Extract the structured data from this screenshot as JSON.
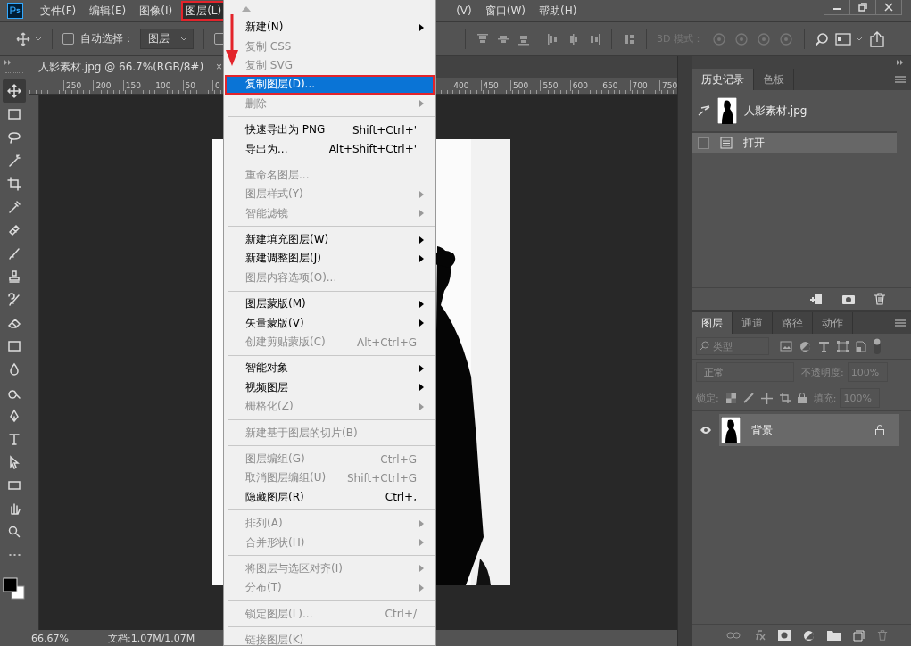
{
  "menubar": {
    "items": [
      {
        "label": "文件(F)",
        "selected": false,
        "annotated": false
      },
      {
        "label": "编辑(E)",
        "selected": false,
        "annotated": false
      },
      {
        "label": "图像(I)",
        "selected": false,
        "annotated": false
      },
      {
        "label": "图层(L)",
        "selected": true,
        "annotated": true
      },
      {
        "label": "(V)",
        "selected": false,
        "annotated": false
      },
      {
        "label": "窗口(W)",
        "selected": false,
        "annotated": false
      },
      {
        "label": "帮助(H)",
        "selected": false,
        "annotated": false
      }
    ]
  },
  "options_bar": {
    "auto_select": {
      "label": "自动选择：",
      "checked": false
    },
    "target": "图层",
    "second_checkbox": {
      "checked": false
    },
    "mode_label": "3D 模式："
  },
  "document_tab": {
    "title": "人影素材.jpg @ 66.7%(RGB/8#)",
    "close": "×"
  },
  "ruler": {
    "labels": [
      "250",
      "200",
      "150",
      "100",
      "50",
      "0",
      "400",
      "450",
      "500",
      "550",
      "600",
      "650",
      "700",
      "750"
    ]
  },
  "menu": {
    "sections": [
      [
        {
          "label": "新建(N)",
          "disabled": false,
          "submenu": true,
          "selected": false,
          "annotated": false
        },
        {
          "label": "复制 CSS",
          "disabled": true,
          "submenu": false,
          "selected": false,
          "annotated": false
        },
        {
          "label": "复制 SVG",
          "disabled": true,
          "submenu": false,
          "selected": false,
          "annotated": false
        },
        {
          "label": "复制图层(D)...",
          "disabled": false,
          "submenu": false,
          "selected": true,
          "annotated": true
        },
        {
          "label": "删除",
          "disabled": true,
          "submenu": true,
          "selected": false,
          "annotated": false
        }
      ],
      [
        {
          "label": "快速导出为 PNG",
          "shortcut": "Shift+Ctrl+'",
          "disabled": false,
          "submenu": false,
          "selected": false,
          "annotated": false
        },
        {
          "label": "导出为...",
          "shortcut": "Alt+Shift+Ctrl+'",
          "disabled": false,
          "submenu": false,
          "selected": false,
          "annotated": false
        }
      ],
      [
        {
          "label": "重命名图层...",
          "disabled": true,
          "submenu": false,
          "selected": false,
          "annotated": false
        },
        {
          "label": "图层样式(Y)",
          "disabled": true,
          "submenu": true,
          "selected": false,
          "annotated": false
        },
        {
          "label": "智能滤镜",
          "disabled": true,
          "submenu": true,
          "selected": false,
          "annotated": false
        }
      ],
      [
        {
          "label": "新建填充图层(W)",
          "disabled": false,
          "submenu": true,
          "selected": false,
          "annotated": false
        },
        {
          "label": "新建调整图层(J)",
          "disabled": false,
          "submenu": true,
          "selected": false,
          "annotated": false
        },
        {
          "label": "图层内容选项(O)...",
          "disabled": true,
          "submenu": false,
          "selected": false,
          "annotated": false
        }
      ],
      [
        {
          "label": "图层蒙版(M)",
          "disabled": false,
          "submenu": true,
          "selected": false,
          "annotated": false
        },
        {
          "label": "矢量蒙版(V)",
          "disabled": false,
          "submenu": true,
          "selected": false,
          "annotated": false
        },
        {
          "label": "创建剪贴蒙版(C)",
          "shortcut": "Alt+Ctrl+G",
          "disabled": true,
          "submenu": false,
          "selected": false,
          "annotated": false
        }
      ],
      [
        {
          "label": "智能对象",
          "disabled": false,
          "submenu": true,
          "selected": false,
          "annotated": false
        },
        {
          "label": "视频图层",
          "disabled": false,
          "submenu": true,
          "selected": false,
          "annotated": false
        },
        {
          "label": "栅格化(Z)",
          "disabled": true,
          "submenu": true,
          "selected": false,
          "annotated": false
        }
      ],
      [
        {
          "label": "新建基于图层的切片(B)",
          "disabled": true,
          "submenu": false,
          "selected": false,
          "annotated": false
        }
      ],
      [
        {
          "label": "图层编组(G)",
          "shortcut": "Ctrl+G",
          "disabled": true,
          "submenu": false,
          "selected": false,
          "annotated": false
        },
        {
          "label": "取消图层编组(U)",
          "shortcut": "Shift+Ctrl+G",
          "disabled": true,
          "submenu": false,
          "selected": false,
          "annotated": false
        },
        {
          "label": "隐藏图层(R)",
          "shortcut": "Ctrl+,",
          "disabled": false,
          "submenu": false,
          "selected": false,
          "annotated": false
        }
      ],
      [
        {
          "label": "排列(A)",
          "disabled": true,
          "submenu": true,
          "selected": false,
          "annotated": false
        },
        {
          "label": "合并形状(H)",
          "disabled": true,
          "submenu": true,
          "selected": false,
          "annotated": false
        }
      ],
      [
        {
          "label": "将图层与选区对齐(I)",
          "disabled": true,
          "submenu": true,
          "selected": false,
          "annotated": false
        },
        {
          "label": "分布(T)",
          "disabled": true,
          "submenu": true,
          "selected": false,
          "annotated": false
        }
      ],
      [
        {
          "label": "锁定图层(L)...",
          "shortcut": "Ctrl+/",
          "disabled": true,
          "submenu": false,
          "selected": false,
          "annotated": false
        }
      ],
      [
        {
          "label": "链接图层(K)",
          "disabled": true,
          "submenu": false,
          "selected": false,
          "annotated": false
        }
      ]
    ]
  },
  "history_panel": {
    "tabs": [
      {
        "label": "历史记录",
        "selected": true
      },
      {
        "label": "色板",
        "selected": false
      }
    ],
    "items": [
      {
        "label": "人影素材.jpg",
        "kind": "snapshot",
        "selected": false
      },
      {
        "label": "打开",
        "kind": "step",
        "selected": true
      }
    ]
  },
  "layers_panel": {
    "tabs": [
      {
        "label": "图层",
        "selected": true
      },
      {
        "label": "通道",
        "selected": false
      },
      {
        "label": "路径",
        "selected": false
      },
      {
        "label": "动作",
        "selected": false
      }
    ],
    "filter": {
      "placeholder": "类型"
    },
    "blend_mode": "正常",
    "opacity_label": "不透明度:",
    "opacity": "100%",
    "lock_label": "锁定:",
    "fill_label": "填充:",
    "fill": "100%",
    "layers": [
      {
        "name": "背景",
        "visible": true,
        "locked": true,
        "selected": true
      }
    ]
  },
  "status_bar": {
    "zoom": "66.67%",
    "doc": "文档:1.07M/1.07M"
  }
}
